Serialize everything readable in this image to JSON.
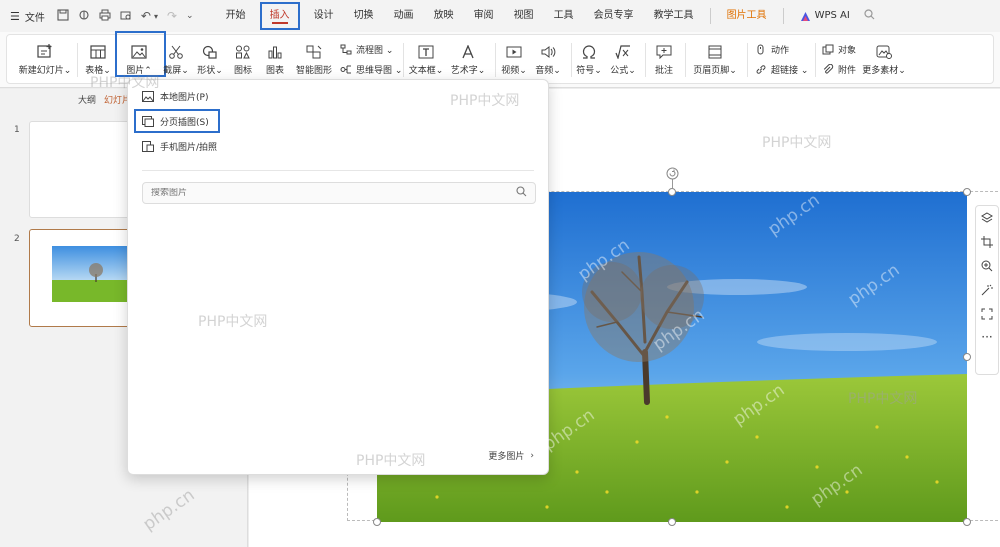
{
  "menubar": {
    "file_label": "文件",
    "tabs": [
      "开始",
      "插入",
      "设计",
      "切换",
      "动画",
      "放映",
      "审阅",
      "视图",
      "工具",
      "会员专享",
      "教学工具"
    ],
    "context_tab": "图片工具",
    "ai_label": "WPS AI"
  },
  "ribbon": {
    "new_slide": "新建幻灯片",
    "table": "表格",
    "picture": "图片",
    "screenshot": "截屏",
    "shape": "形状",
    "icon": "图标",
    "chart": "图表",
    "smart_graphic": "智能图形",
    "flowchart": "流程图",
    "mindmap": "思维导图",
    "textbox": "文本框",
    "wordart": "艺术字",
    "video": "视频",
    "audio": "音频",
    "symbol": "符号",
    "formula": "公式",
    "comment": "批注",
    "header_footer": "页眉页脚",
    "action": "动作",
    "hyperlink": "超链接",
    "object": "对象",
    "attachment": "附件",
    "more_material": "更多素材"
  },
  "left_panel": {
    "outline_tab": "大纲",
    "slides_tab": "幻灯片",
    "slide_numbers": [
      "1",
      "2"
    ]
  },
  "dropdown": {
    "local_picture": "本地图片(P)",
    "page_insert": "分页插图(S)",
    "phone_picture": "手机图片/拍照",
    "search_placeholder": "搜索图片",
    "more_pictures": "更多图片"
  },
  "watermarks": {
    "cn": "PHP中文网",
    "site": "php.cn"
  }
}
